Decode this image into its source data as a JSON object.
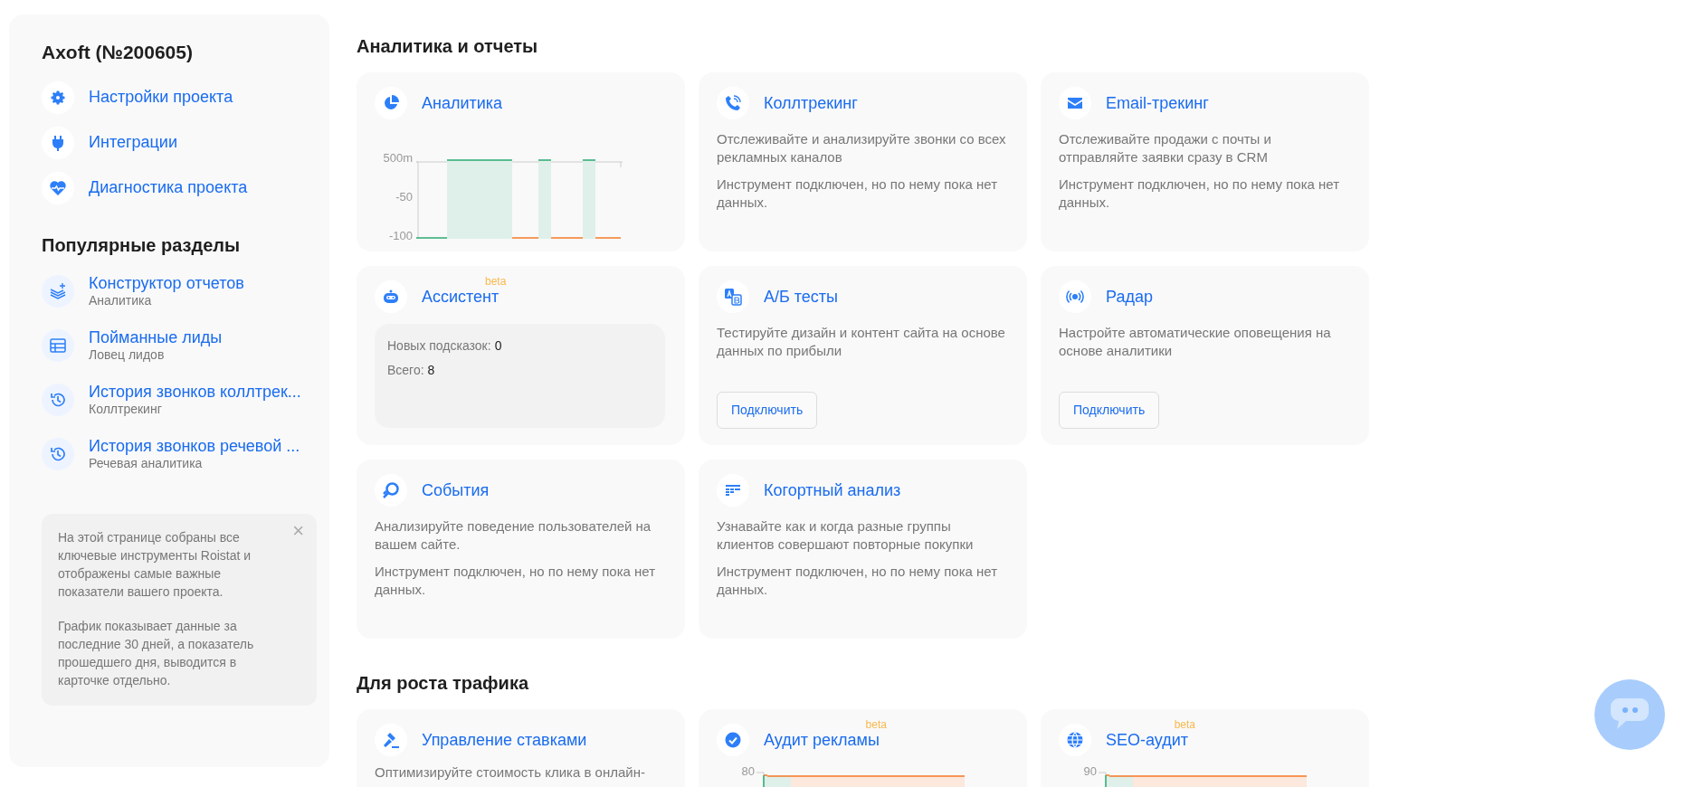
{
  "sidebar": {
    "title": "Axoft (№200605)",
    "nav": [
      {
        "label": "Настройки проекта"
      },
      {
        "label": "Интеграции"
      },
      {
        "label": "Диагностика проекта"
      }
    ],
    "popular_title": "Популярные разделы",
    "popular": [
      {
        "title": "Конструктор отчетов",
        "subtitle": "Аналитика"
      },
      {
        "title": "Пойманные лиды",
        "subtitle": "Ловец лидов"
      },
      {
        "title": "История звонков коллтрек...",
        "subtitle": "Коллтрекинг"
      },
      {
        "title": "История звонков речевой ...",
        "subtitle": "Речевая аналитика"
      }
    ],
    "info": {
      "paragraphs": [
        "На этой странице собраны все ключевые инструменты Roistat и отображены самые важные показатели вашего проекта.",
        "График показывает данные за последние 30 дней, а показатель прошедшего дня, выводится в карточке отдельно."
      ],
      "close": "×"
    }
  },
  "sections": [
    {
      "title": "Аналитика и отчеты",
      "cards": [
        {
          "kind": "chart",
          "title": "Аналитика",
          "ticks": [
            "500m",
            "-50",
            "-100"
          ]
        },
        {
          "kind": "text",
          "title": "Коллтрекинг",
          "description": "Отслеживайте и анализируйте звонки со всех рекламных каналов",
          "status": "Инструмент подключен, но по нему пока нет данных."
        },
        {
          "kind": "text",
          "title": "Email-трекинг",
          "description": "Отслеживайте продажи с почты и отправляйте заявки сразу в CRM",
          "status": "Инструмент подключен, но по нему пока нет данных."
        },
        {
          "kind": "assistant",
          "title": "Ассистент",
          "badge": "beta",
          "stats": [
            {
              "label": "Новых подсказок:",
              "value": "0"
            },
            {
              "label": "Всего:",
              "value": "8"
            }
          ]
        },
        {
          "kind": "connect",
          "title": "А/Б тесты",
          "description": "Тестируйте дизайн и контент сайта на основе данных по прибыли",
          "button": "Подключить"
        },
        {
          "kind": "connect",
          "title": "Радар",
          "description": "Настройте автоматические оповещения на основе аналитики",
          "button": "Подключить"
        },
        {
          "kind": "text",
          "title": "События",
          "description": "Анализируйте поведение пользователей на вашем сайте.",
          "status": "Инструмент подключен, но по нему пока нет данных."
        },
        {
          "kind": "text",
          "title": "Когортный анализ",
          "description": "Узнавайте как и когда разные группы клиентов совершают повторные покупки",
          "status": "Инструмент подключен, но по нему пока нет данных."
        }
      ]
    },
    {
      "title": "Для роста трафика",
      "cards": [
        {
          "kind": "text",
          "title": "Управление ставками",
          "description": "Оптимизируйте стоимость клика в онлайн-"
        },
        {
          "kind": "chart",
          "title": "Аудит рекламы",
          "badge": "beta",
          "ticks": [
            "80"
          ]
        },
        {
          "kind": "chart",
          "title": "SEO-аудит",
          "badge": "beta",
          "ticks": [
            "90"
          ]
        }
      ]
    }
  ]
}
